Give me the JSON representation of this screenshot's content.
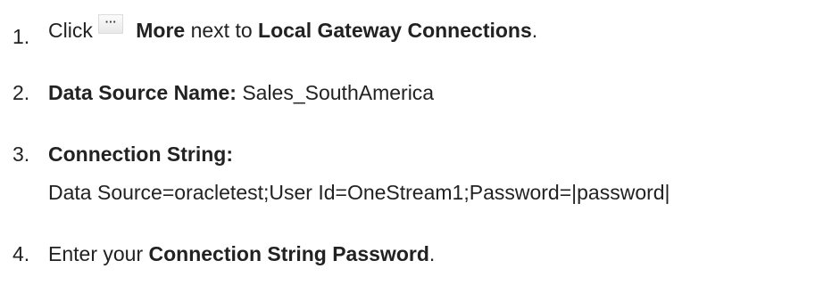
{
  "steps": [
    {
      "number": "1.",
      "click": "Click",
      "more_icon": "ellipsis-more-icon",
      "more_label": "More",
      "next_to": "next to",
      "target": "Local Gateway Connections",
      "end": "."
    },
    {
      "number": "2.",
      "label": "Data Source Name:",
      "value": "Sales_SouthAmerica"
    },
    {
      "number": "3.",
      "label": "Connection String:",
      "value": "Data Source=oracletest;User Id=OneStream1;Password=|password|"
    },
    {
      "number": "4.",
      "prefix": "Enter your",
      "label": "Connection String Password",
      "end": "."
    }
  ]
}
